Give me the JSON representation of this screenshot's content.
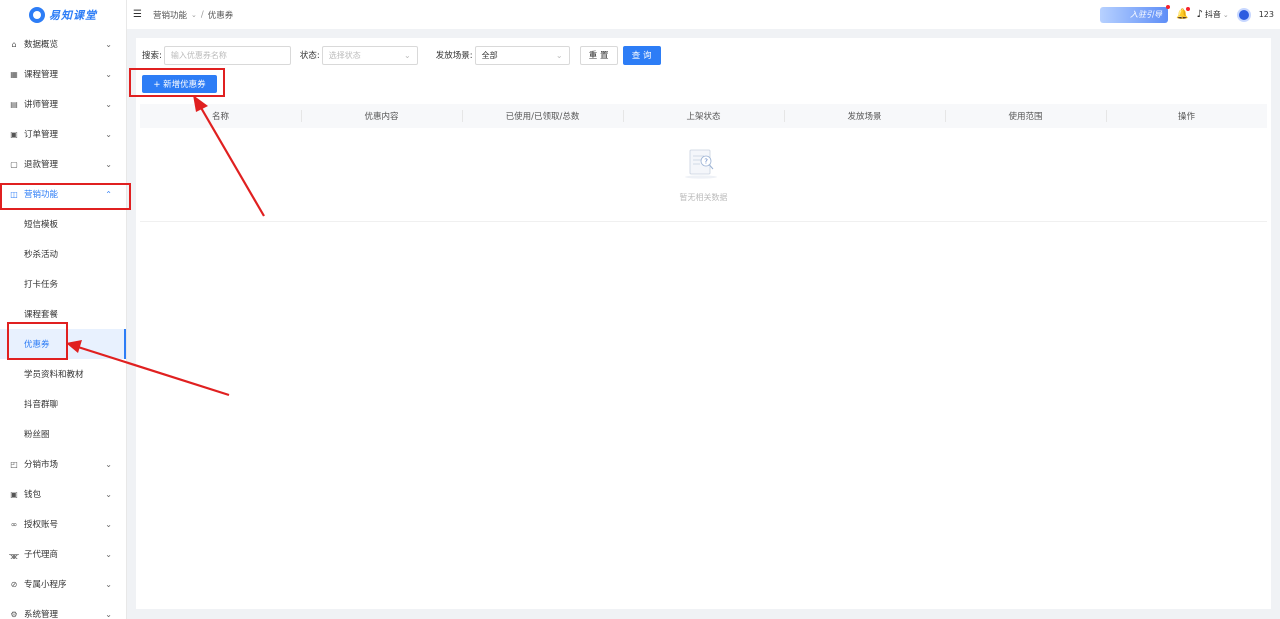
{
  "app": {
    "logo_text": "易知课堂"
  },
  "header": {
    "breadcrumb": [
      "营销功能",
      "优惠券"
    ],
    "breadcrumb_sep": "/",
    "settle_label": "入驻引导",
    "douyin_label": "抖音",
    "username": "123"
  },
  "sidebar": {
    "items": [
      {
        "label": "数据概览",
        "icon": "home-icon"
      },
      {
        "label": "课程管理",
        "icon": "grid-icon"
      },
      {
        "label": "讲师管理",
        "icon": "id-card-icon"
      },
      {
        "label": "订单管理",
        "icon": "order-icon"
      },
      {
        "label": "退款管理",
        "icon": "refund-icon"
      },
      {
        "label": "营销功能",
        "icon": "bag-icon",
        "expanded": true
      },
      {
        "label": "分销市场",
        "icon": "market-icon"
      },
      {
        "label": "钱包",
        "icon": "wallet-icon"
      },
      {
        "label": "授权账号",
        "icon": "link-icon"
      },
      {
        "label": "子代理商",
        "icon": "agent-icon"
      },
      {
        "label": "专属小程序",
        "icon": "miniapp-icon"
      },
      {
        "label": "系统管理",
        "icon": "gear-icon"
      }
    ],
    "submenu": [
      "短信模板",
      "秒杀活动",
      "打卡任务",
      "课程套餐",
      "优惠券",
      "学员资料和教材",
      "抖音群聊",
      "粉丝圈"
    ],
    "selected_sub": "优惠券"
  },
  "filters": {
    "search_label": "搜索:",
    "search_placeholder": "输入优惠券名称",
    "status_label": "状态:",
    "status_placeholder": "选择状态",
    "scene_label": "发放场景:",
    "scene_value": "全部",
    "reset_label": "重 置",
    "query_label": "查 询"
  },
  "add_button_label": "+ 新增优惠券",
  "table": {
    "columns": [
      "名称",
      "优惠内容",
      "已使用/已领取/总数",
      "上架状态",
      "发放场景",
      "使用范围",
      "操作"
    ],
    "rows": [],
    "empty_text": "暂无相关数据"
  },
  "colors": {
    "accent": "#2d7df6",
    "annotation": "#e02020"
  }
}
